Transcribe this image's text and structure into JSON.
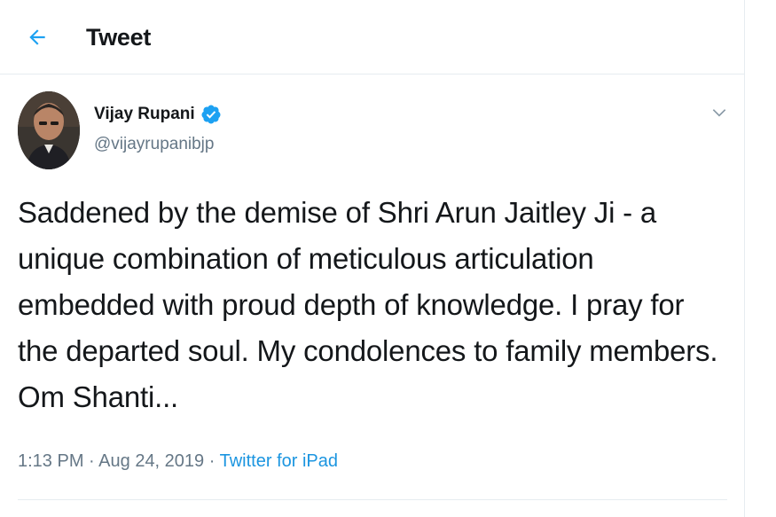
{
  "header": {
    "title": "Tweet",
    "back_icon": "arrow-left-icon"
  },
  "tweet": {
    "author_name": "Vijay Rupani",
    "author_handle": "@vijayrupanibjp",
    "verified_icon": "verified-badge-icon",
    "menu_icon": "chevron-down-icon",
    "text_lines": [
      "Saddened by the demise of Shri Arun Jaitley Ji - a",
      "unique combination of meticulous articulation",
      "embedded with proud depth of knowledge. I pray for",
      "the departed soul. My condolences to family members.",
      "Om Shanti..."
    ],
    "time": "1:13 PM",
    "separator": "·",
    "date": "Aug 24, 2019",
    "source": "Twitter for iPad"
  },
  "colors": {
    "accent": "#1da1f2",
    "link": "#1b95e0",
    "text": "#14171a",
    "muted": "#657786",
    "border": "#e6ecf0"
  }
}
